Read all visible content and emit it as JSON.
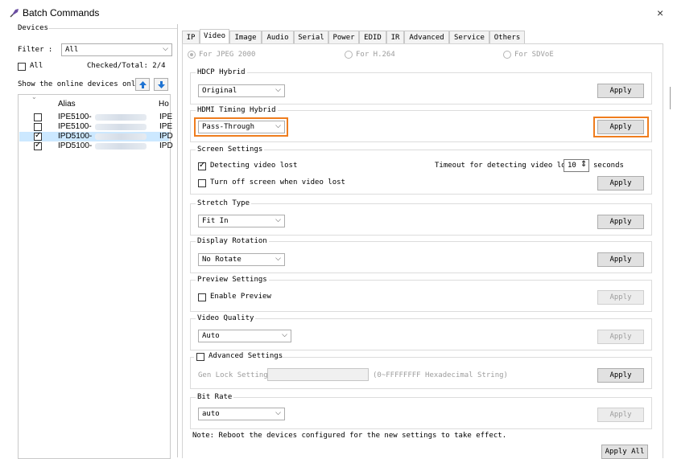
{
  "window": {
    "title": "Batch Commands",
    "close": "×"
  },
  "left": {
    "devices_label": "Devices",
    "filter_label": "Filter :",
    "filter_value": "All",
    "all_label": "All",
    "checked_total": "Checked/Total: 2/4",
    "online_only_label": "Show the online devices only.",
    "list": {
      "headers": {
        "alias": "Alias",
        "host": "Ho"
      },
      "rows": [
        {
          "alias": "IPE5100-",
          "host": "IPE",
          "checked": false,
          "selected": false
        },
        {
          "alias": "IPE5100-",
          "host": "IPE",
          "checked": false,
          "selected": false
        },
        {
          "alias": "IPD5100-",
          "host": "IPD",
          "checked": true,
          "selected": true
        },
        {
          "alias": "IPD5100-",
          "host": "IPD",
          "checked": true,
          "selected": false
        }
      ]
    }
  },
  "tabs": [
    "IP",
    "Video",
    "Image",
    "Audio",
    "Serial",
    "Power",
    "EDID",
    "IR",
    "Advanced",
    "Service",
    "Others"
  ],
  "active_tab": "Video",
  "video": {
    "modes": {
      "jpeg": "For JPEG 2000",
      "h264": "For H.264",
      "sdvoe": "For SDVoE"
    },
    "hdcp": {
      "title": "HDCP Hybrid",
      "value": "Original",
      "apply": "Apply"
    },
    "hdmi": {
      "title": "HDMI Timing Hybrid",
      "value": "Pass-Through",
      "apply": "Apply"
    },
    "screen": {
      "title": "Screen Settings",
      "detect_label": "Detecting video lost",
      "timeout_label": "Timeout for detecting video lost:",
      "timeout_value": "10",
      "seconds": "seconds",
      "turnoff_label": "Turn off screen when video lost",
      "apply": "Apply"
    },
    "stretch": {
      "title": "Stretch Type",
      "value": "Fit In",
      "apply": "Apply"
    },
    "rotation": {
      "title": "Display Rotation",
      "value": "No Rotate",
      "apply": "Apply"
    },
    "preview": {
      "title": "Preview Settings",
      "enable_label": "Enable Preview",
      "apply": "Apply"
    },
    "quality": {
      "title": "Video Quality",
      "value": "Auto",
      "apply": "Apply"
    },
    "advanced": {
      "title": "Advanced Settings",
      "genlock_label": "Gen Lock Setting:",
      "genlock_hint": "(0~FFFFFFFF Hexadecimal String)",
      "apply": "Apply"
    },
    "bitrate": {
      "title": "Bit Rate",
      "value": "auto",
      "apply": "Apply"
    },
    "note": "Note: Reboot the devices configured for the new settings to take effect.",
    "apply_all": "Apply All"
  },
  "colors": {
    "highlight": "#ef7d1e",
    "selection": "#cce8ff",
    "arrow_blue": "#1e73d2"
  }
}
